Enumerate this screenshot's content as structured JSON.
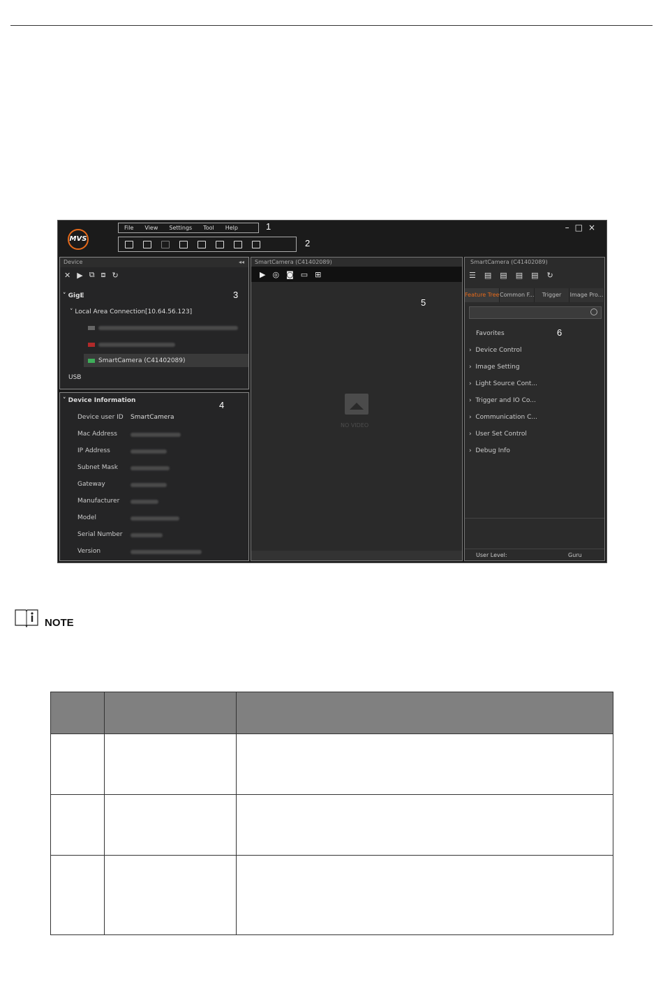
{
  "app": {
    "logo": "MVS",
    "menu": [
      "File",
      "View",
      "Settings",
      "Tool",
      "Help"
    ],
    "window_controls": [
      "–",
      "□",
      "×"
    ],
    "callouts": [
      "1",
      "2",
      "3",
      "4",
      "5",
      "6"
    ],
    "device_panel": {
      "title": "Device",
      "collapse": "◂◂",
      "gige": "GigE",
      "connection": "Local Area Connection[10.64.56.123]",
      "selected_camera": "SmartCamera (C41402089)",
      "usb": "USB"
    },
    "info_panel": {
      "title": "Device Information",
      "rows": [
        {
          "label": "Device user ID",
          "value": "SmartCamera"
        },
        {
          "label": "Mac Address",
          "value": ""
        },
        {
          "label": "IP Address",
          "value": ""
        },
        {
          "label": "Subnet Mask",
          "value": ""
        },
        {
          "label": "Gateway",
          "value": ""
        },
        {
          "label": "Manufacturer",
          "value": ""
        },
        {
          "label": "Model",
          "value": ""
        },
        {
          "label": "Serial Number",
          "value": ""
        },
        {
          "label": "Version",
          "value": ""
        }
      ]
    },
    "video_panel": {
      "title": "SmartCamera (C41402089)",
      "placeholder": "NO VIDEO"
    },
    "feature_panel": {
      "title": "SmartCamera (C41402089)",
      "tabs": [
        "Feature Tree",
        "Common F...",
        "Trigger",
        "Image Pro..."
      ],
      "items": [
        "Favorites",
        "Device Control",
        "Image Setting",
        "Light Source Cont...",
        "Trigger and IO Co...",
        "Communication C...",
        "User Set Control",
        "Debug Info"
      ],
      "user_level_label": "User Level:",
      "user_level_value": "Guru"
    }
  },
  "note": {
    "label": "NOTE"
  },
  "colors": {
    "accent": "#e66a1a",
    "table_header": "#808080"
  }
}
